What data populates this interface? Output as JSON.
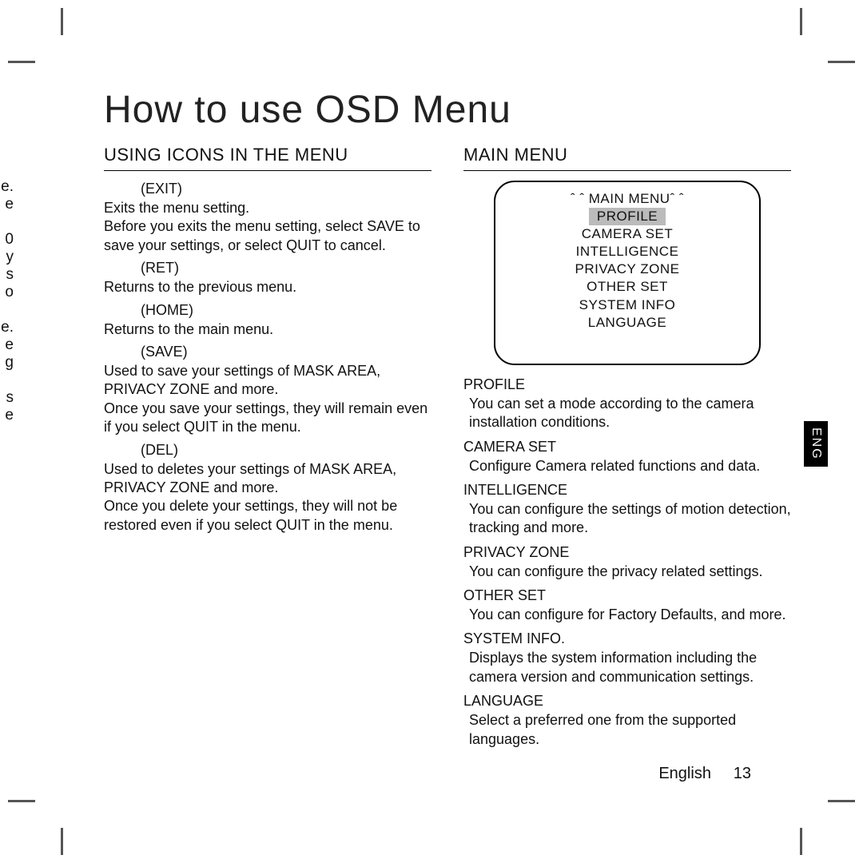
{
  "title": "How to use OSD Menu",
  "left": {
    "heading": "USING ICONS IN THE MENU",
    "items": [
      {
        "label": "(EXIT)",
        "desc": "Exits the menu setting.\nBefore you exits the menu setting, select SAVE to save your settings, or select QUIT to cancel."
      },
      {
        "label": "(RET)",
        "desc": "Returns to the previous menu."
      },
      {
        "label": "(HOME)",
        "desc": "Returns to the main menu."
      },
      {
        "label": "(SAVE)",
        "desc": "Used to save your settings of MASK AREA, PRIVACY ZONE and more.\nOnce you save your settings, they will remain even if you select QUIT in the menu."
      },
      {
        "label": "(DEL)",
        "desc": "Used to deletes your settings of MASK AREA, PRIVACY ZONE and more.\nOnce you delete your settings, they will not be restored even if you select QUIT in the menu."
      }
    ]
  },
  "right": {
    "heading": "MAIN MENU",
    "menu_title": "ˆ ˆ  MAIN MENUˆ ˆ",
    "menu_items": [
      "PROFILE",
      "CAMERA SET",
      "INTELLIGENCE",
      "PRIVACY ZONE",
      "OTHER SET",
      "SYSTEM INFO",
      "LANGUAGE"
    ],
    "descriptions": [
      {
        "label": "PROFILE",
        "desc": "You can set a mode according to the camera installation conditions."
      },
      {
        "label": "CAMERA SET",
        "desc": "Conﬁgure Camera related functions and data."
      },
      {
        "label": "INTELLIGENCE",
        "desc": "You can conﬁgure the settings of motion detection, tracking and more."
      },
      {
        "label": "PRIVACY ZONE",
        "desc": "You can conﬁgure the privacy related settings."
      },
      {
        "label": "OTHER SET",
        "desc": "You can conﬁgure for Factory Defaults, and more."
      },
      {
        "label": "SYSTEM INFO.",
        "desc": "Displays the system information including the camera version and communication settings."
      },
      {
        "label": "LANGUAGE",
        "desc": "Select a preferred one from the supported languages."
      }
    ]
  },
  "tab": "ENG",
  "footer_lang": "English",
  "footer_page": "13",
  "edge": [
    "e.",
    "e",
    "",
    "0",
    "y",
    "s",
    "o",
    "",
    "e.",
    "e",
    "g",
    "",
    "s",
    "e"
  ]
}
